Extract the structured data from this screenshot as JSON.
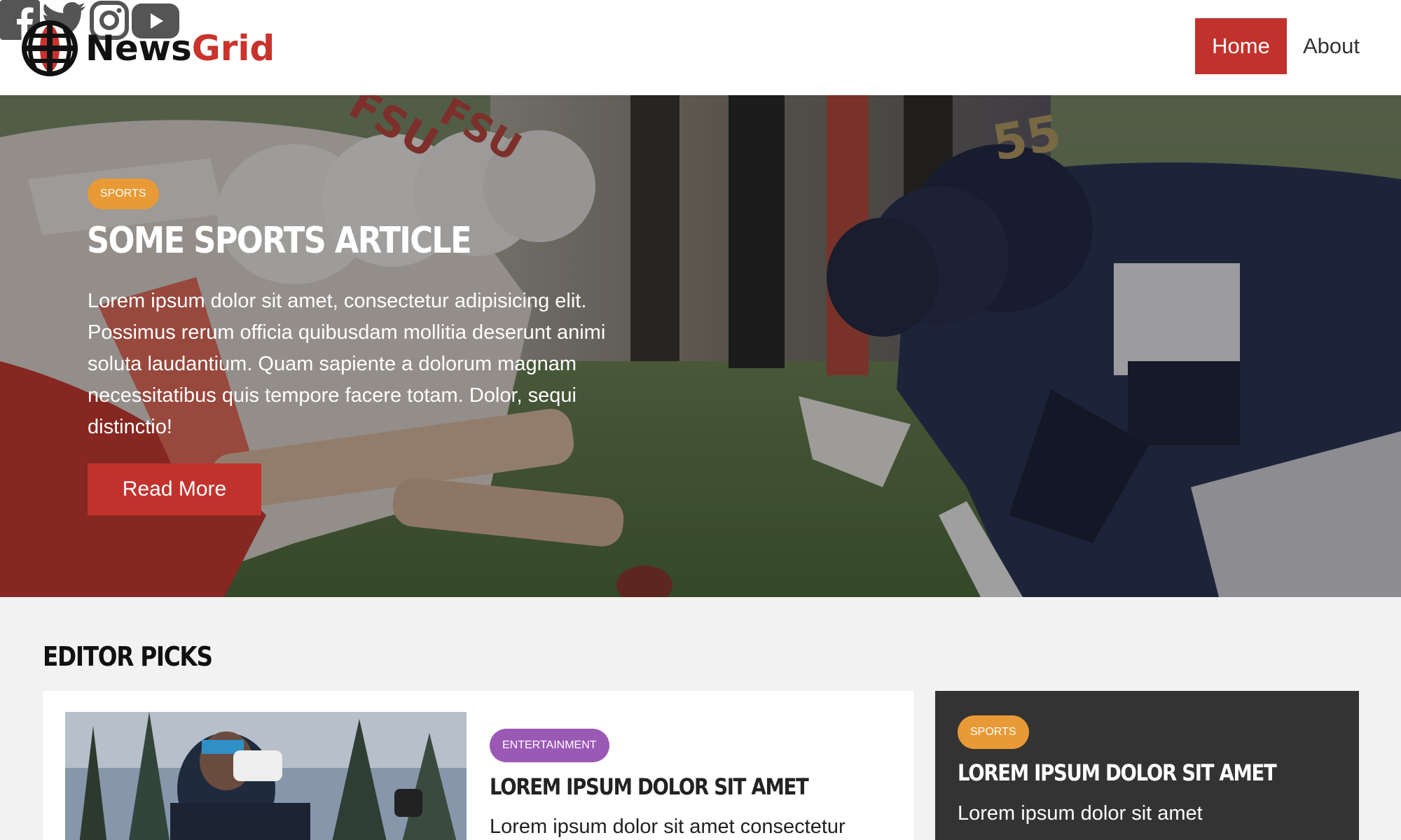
{
  "brand": {
    "name_part1": "News",
    "name_part2": "Grid",
    "accent": "#c8332c"
  },
  "social": [
    {
      "icon": "facebook-icon"
    },
    {
      "icon": "twitter-icon"
    },
    {
      "icon": "instagram-icon"
    },
    {
      "icon": "youtube-icon"
    }
  ],
  "nav": {
    "home": "Home",
    "about": "About"
  },
  "hero": {
    "badge": "SPORTS",
    "title": "SOME SPORTS ARTICLE",
    "text": "Lorem ipsum dolor sit amet, consectetur adipisicing elit. Possimus rerum officia quibusdam mollitia deserunt animi soluta laudantium. Quam sapiente a dolorum magnam necessitatibus quis tempore facere totam. Dolor, sequi distinctio!",
    "button": "Read More"
  },
  "editor_picks": {
    "title": "EDITOR PICKS",
    "main_card": {
      "badge": "ENTERTAINMENT",
      "title": "LOREM IPSUM DOLOR SIT AMET",
      "text": "Lorem ipsum dolor sit amet consectetur"
    },
    "side_card": {
      "badge": "SPORTS",
      "title": "LOREM IPSUM DOLOR SIT AMET",
      "text": "Lorem ipsum dolor sit amet"
    }
  },
  "colors": {
    "sports_badge": "#e89a36",
    "entertainment_badge": "#9b59b6",
    "primary_button": "#c2322c",
    "dark_card": "#333333"
  }
}
